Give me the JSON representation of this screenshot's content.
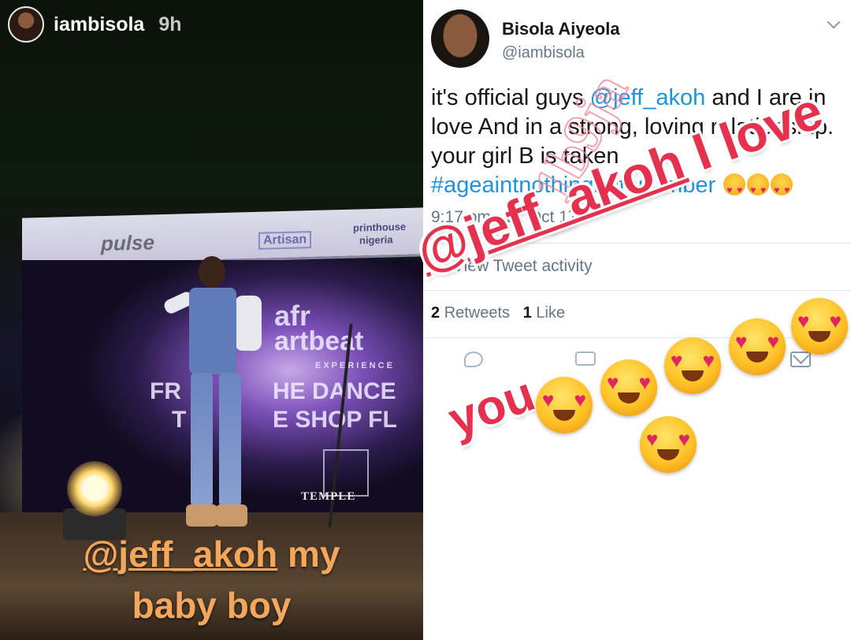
{
  "story": {
    "username": "iambisola",
    "time_ago": "9h",
    "caption_line1_mention": "@jeff_akoh",
    "caption_line1_rest": " my",
    "caption_line2": "baby boy",
    "sponsors": [
      "pulse",
      "Artisan",
      "printhouse",
      "nigeria"
    ],
    "backdrop_text": [
      "afr",
      "artbeat",
      "EXPERIENCE",
      "FR",
      "HE DANCE",
      "T",
      "E SHOP FL"
    ],
    "temple_text": "TEMPLE"
  },
  "tweet": {
    "name": "Bisola Aiyeola",
    "handle": "@iambisola",
    "text_part1": "it's official guys ",
    "mention": "@jeff_akoh",
    "text_part2": " and I are in love And in a strong, loving relationship. your girl B is taken ",
    "hashtag": "#ageaintnothingbutanumber",
    "timestamp": "9:17 pm · 21 Oct 17",
    "activity_label": "View Tweet activity",
    "retweets_count": "2",
    "retweets_label": "Retweets",
    "likes_count": "1",
    "likes_label": "Like"
  },
  "overlay": {
    "watermark": "1b9ja",
    "love_mention": "@jeff_akoh",
    "love_rest": " I love",
    "love_line2": "you"
  },
  "colors": {
    "caption_orange": "#f4a75c",
    "love_red": "#e5314e",
    "twitter_link": "#1b95e0",
    "twitter_gray": "#657786"
  },
  "icons": [
    "reply-icon",
    "retweet-icon",
    "like-icon",
    "message-icon",
    "analytics-bars-icon",
    "chevron-down-icon",
    "heart-eyes-emoji"
  ]
}
